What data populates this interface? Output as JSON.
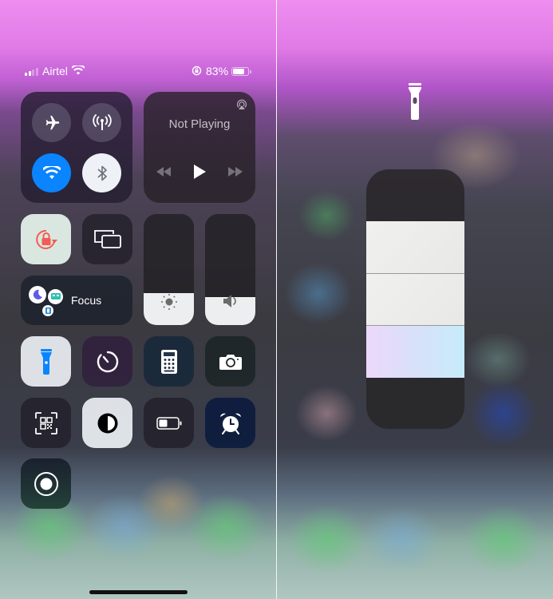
{
  "status_bar": {
    "carrier": "Airtel",
    "signal_bars": 4,
    "signal_bars_active": 2,
    "battery_percent": "83%",
    "battery_level": 0.83,
    "icons": [
      "signal-icon",
      "wifi-icon",
      "rotation-lock-icon",
      "battery-icon"
    ]
  },
  "connectivity": {
    "airplane": {
      "icon": "airplane-icon",
      "active": false
    },
    "cellular": {
      "icon": "cellular-antenna-icon",
      "active": false
    },
    "wifi": {
      "icon": "wifi-icon",
      "active": true
    },
    "bluetooth": {
      "icon": "bluetooth-icon",
      "active": false
    }
  },
  "now_playing": {
    "title": "Not Playing",
    "icons": [
      "airplay-icon",
      "rewind-icon",
      "play-icon",
      "fast-forward-icon"
    ]
  },
  "controls": {
    "orientation_lock": {
      "icon": "orientation-lock-icon",
      "active": true
    },
    "screen_mirroring": {
      "icon": "screen-mirroring-icon"
    },
    "brightness": {
      "icon": "sun-icon",
      "level": 0.29
    },
    "volume": {
      "icon": "speaker-icon",
      "level": 0.25
    },
    "focus": {
      "label": "Focus",
      "icons": [
        "moon-icon",
        "bed-icon",
        "work-icon"
      ]
    }
  },
  "shortcuts": [
    {
      "name": "flashlight",
      "icon": "flashlight-icon",
      "active": true
    },
    {
      "name": "timer",
      "icon": "timer-icon",
      "active": false
    },
    {
      "name": "calculator",
      "icon": "calculator-icon",
      "active": false
    },
    {
      "name": "camera",
      "icon": "camera-icon",
      "active": false
    },
    {
      "name": "code-scanner",
      "icon": "qr-code-icon",
      "active": false
    },
    {
      "name": "dark-mode",
      "icon": "dark-mode-icon",
      "active": true
    },
    {
      "name": "low-power-mode",
      "icon": "battery-icon",
      "active": false
    },
    {
      "name": "alarm",
      "icon": "alarm-clock-icon",
      "active": false
    },
    {
      "name": "screen-recording",
      "icon": "record-icon",
      "active": false
    }
  ],
  "flashlight_panel": {
    "icon": "flashlight-icon",
    "segments": 5,
    "level_segments": 3,
    "level": 0.6
  },
  "colors": {
    "accent_blue": "#0a84ff",
    "orientation_lock_red": "#f25c54",
    "alarm_tile": "#0d1b3e"
  }
}
